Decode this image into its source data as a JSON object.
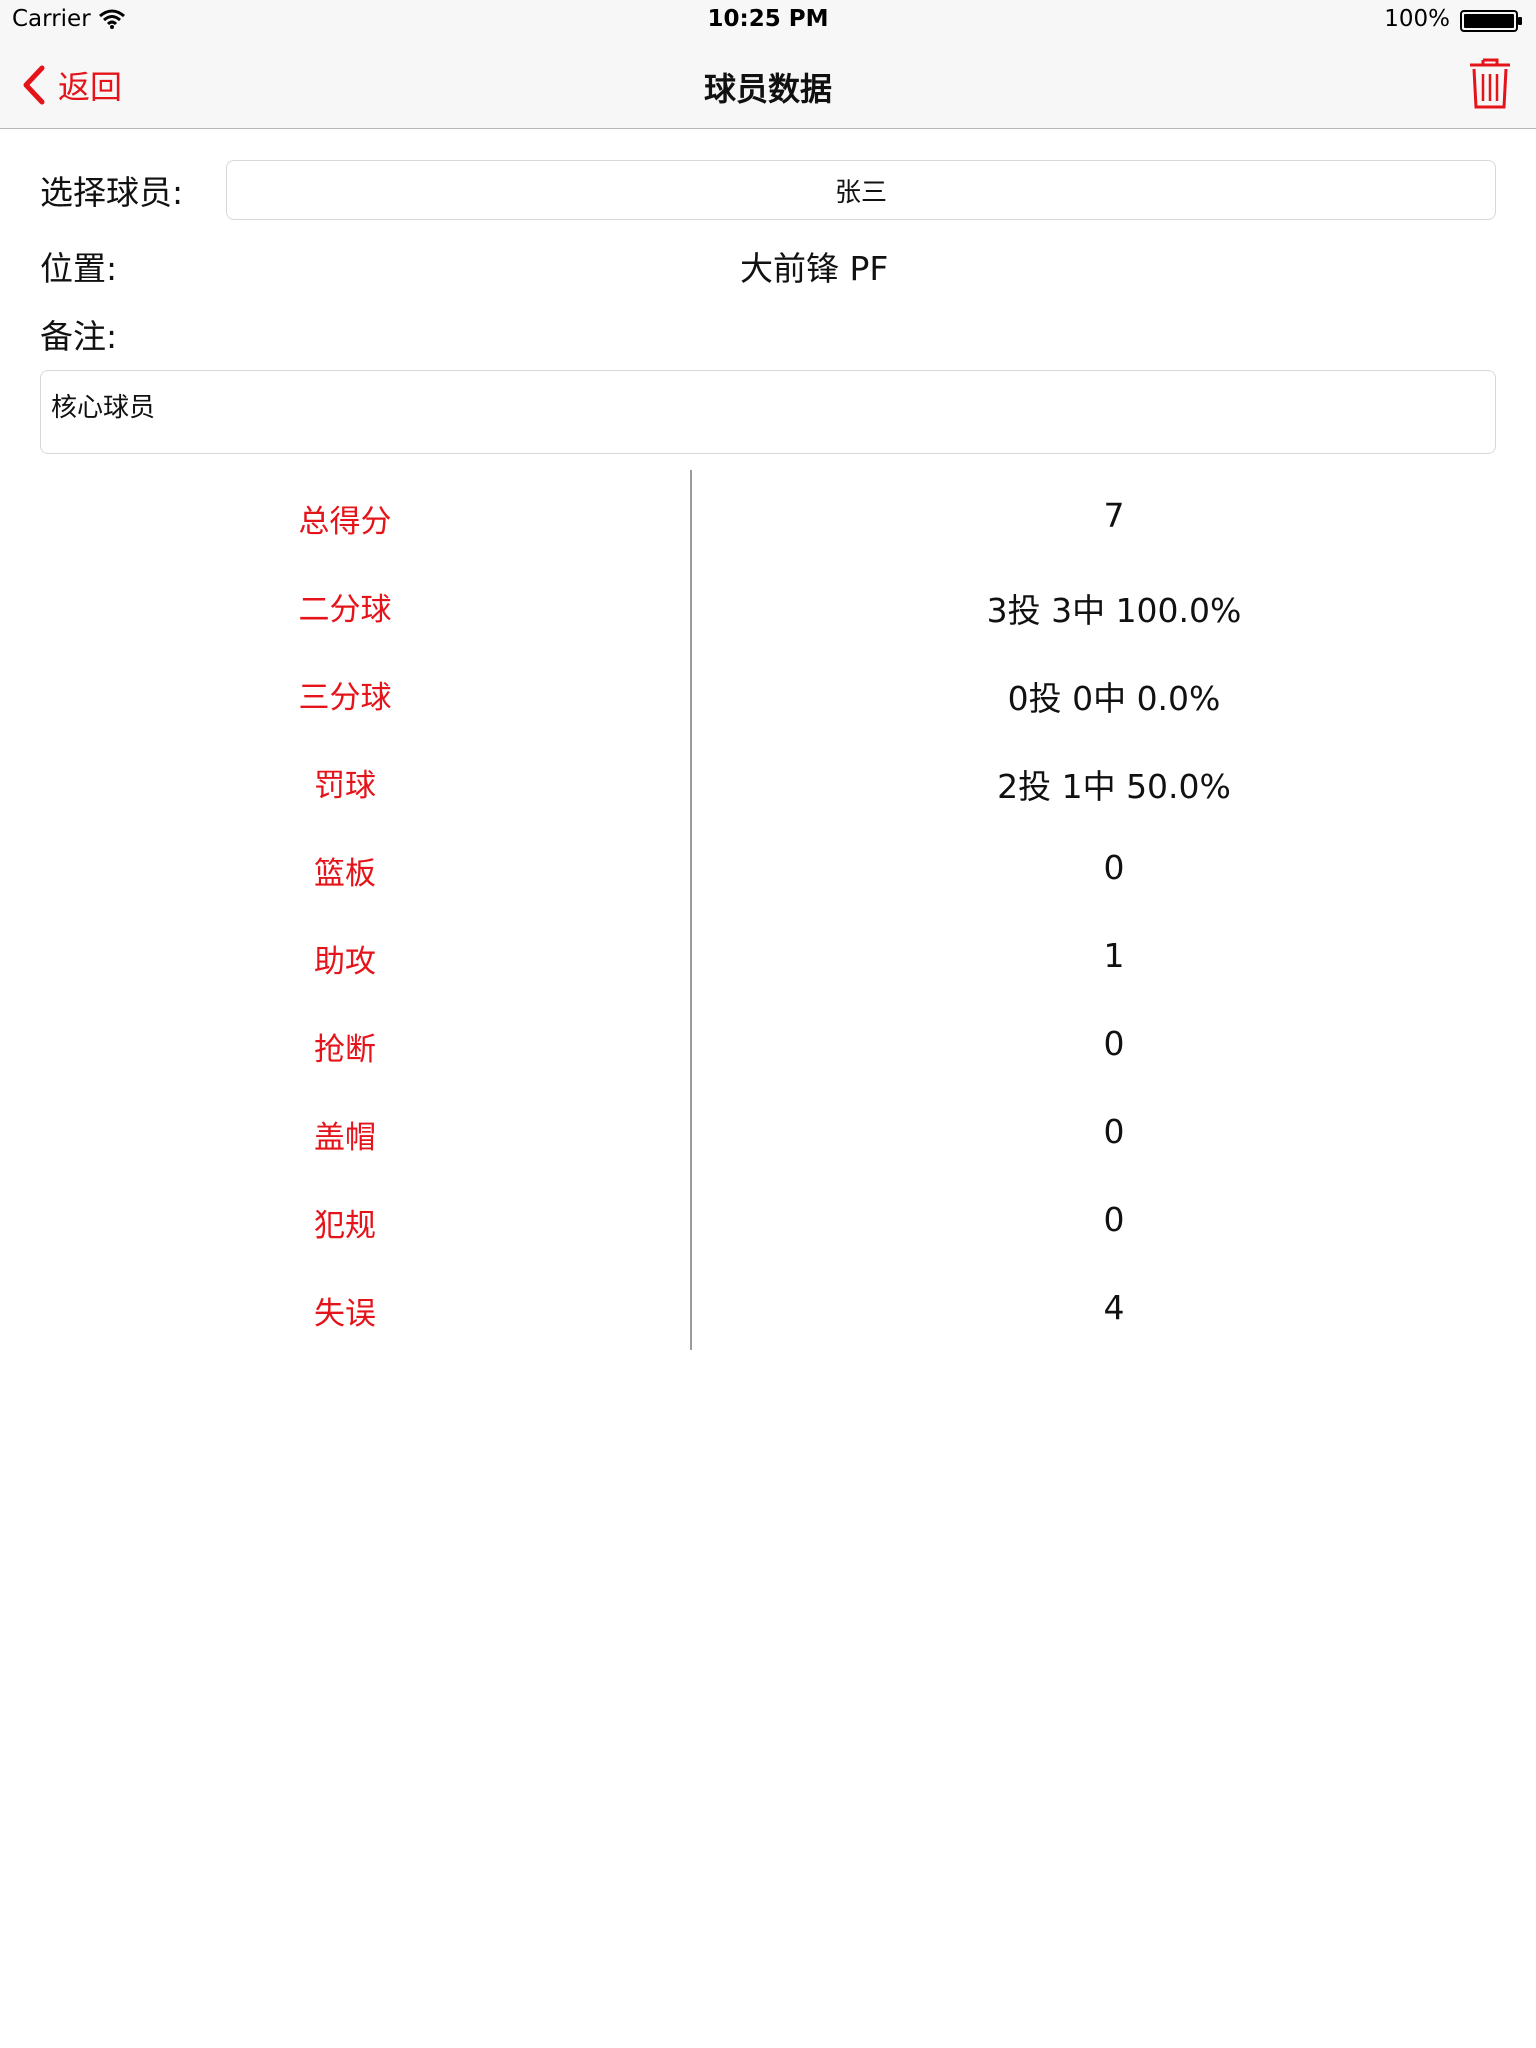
{
  "status_bar": {
    "carrier": "Carrier",
    "time": "10:25 PM",
    "battery": "100%"
  },
  "nav": {
    "back_label": "返回",
    "title": "球员数据",
    "trash_icon": "trash-icon",
    "accent_color": "#e5141a"
  },
  "form": {
    "player_label": "选择球员:",
    "player_value": "张三",
    "position_label": "位置:",
    "position_value": "大前锋 PF",
    "note_label": "备注:",
    "note_value": "核心球员"
  },
  "stats": [
    {
      "label": "总得分",
      "value": "7"
    },
    {
      "label": "二分球",
      "value": "3投 3中 100.0%"
    },
    {
      "label": "三分球",
      "value": "0投 0中 0.0%"
    },
    {
      "label": "罚球",
      "value": "2投 1中 50.0%"
    },
    {
      "label": "篮板",
      "value": "0"
    },
    {
      "label": "助攻",
      "value": "1"
    },
    {
      "label": "抢断",
      "value": "0"
    },
    {
      "label": "盖帽",
      "value": "0"
    },
    {
      "label": "犯规",
      "value": "0"
    },
    {
      "label": "失误",
      "value": "4"
    }
  ]
}
